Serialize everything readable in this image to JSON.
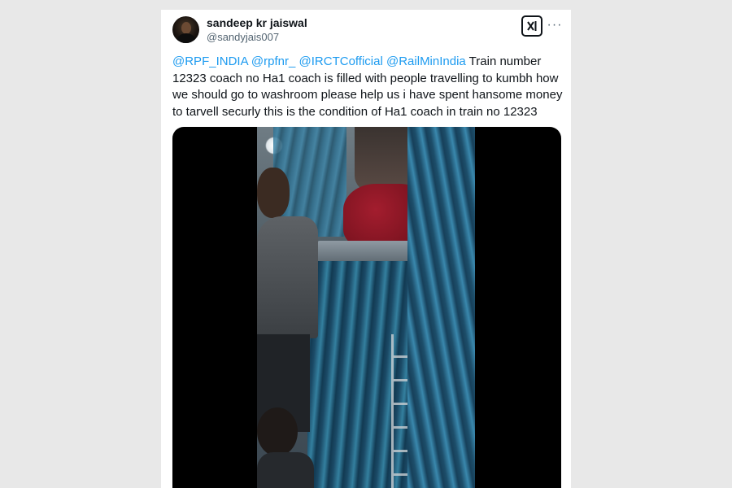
{
  "post": {
    "author": {
      "display_name": "sandeep kr jaiswal",
      "handle": "@sandyjais007"
    },
    "actions": {
      "grok_icon": "grok-icon",
      "more_icon": "more-icon",
      "more_glyph": "···"
    },
    "text": {
      "mentions": [
        "@RPF_INDIA",
        "@rpfnr_",
        "@IRCTCofficial",
        "@RailMinIndia"
      ],
      "body": "Train number 12323 coach no Ha1 coach is filled with people travelling to kumbh how we should go to washroom please help us i have spent hansome money to tarvell securly  this is the condition of Ha1 coach in train no 12323"
    },
    "media": {
      "type": "video"
    }
  },
  "colors": {
    "mention": "#1d9bf0",
    "text": "#0f1419",
    "secondary": "#536471",
    "background": "#e8e8e8"
  }
}
